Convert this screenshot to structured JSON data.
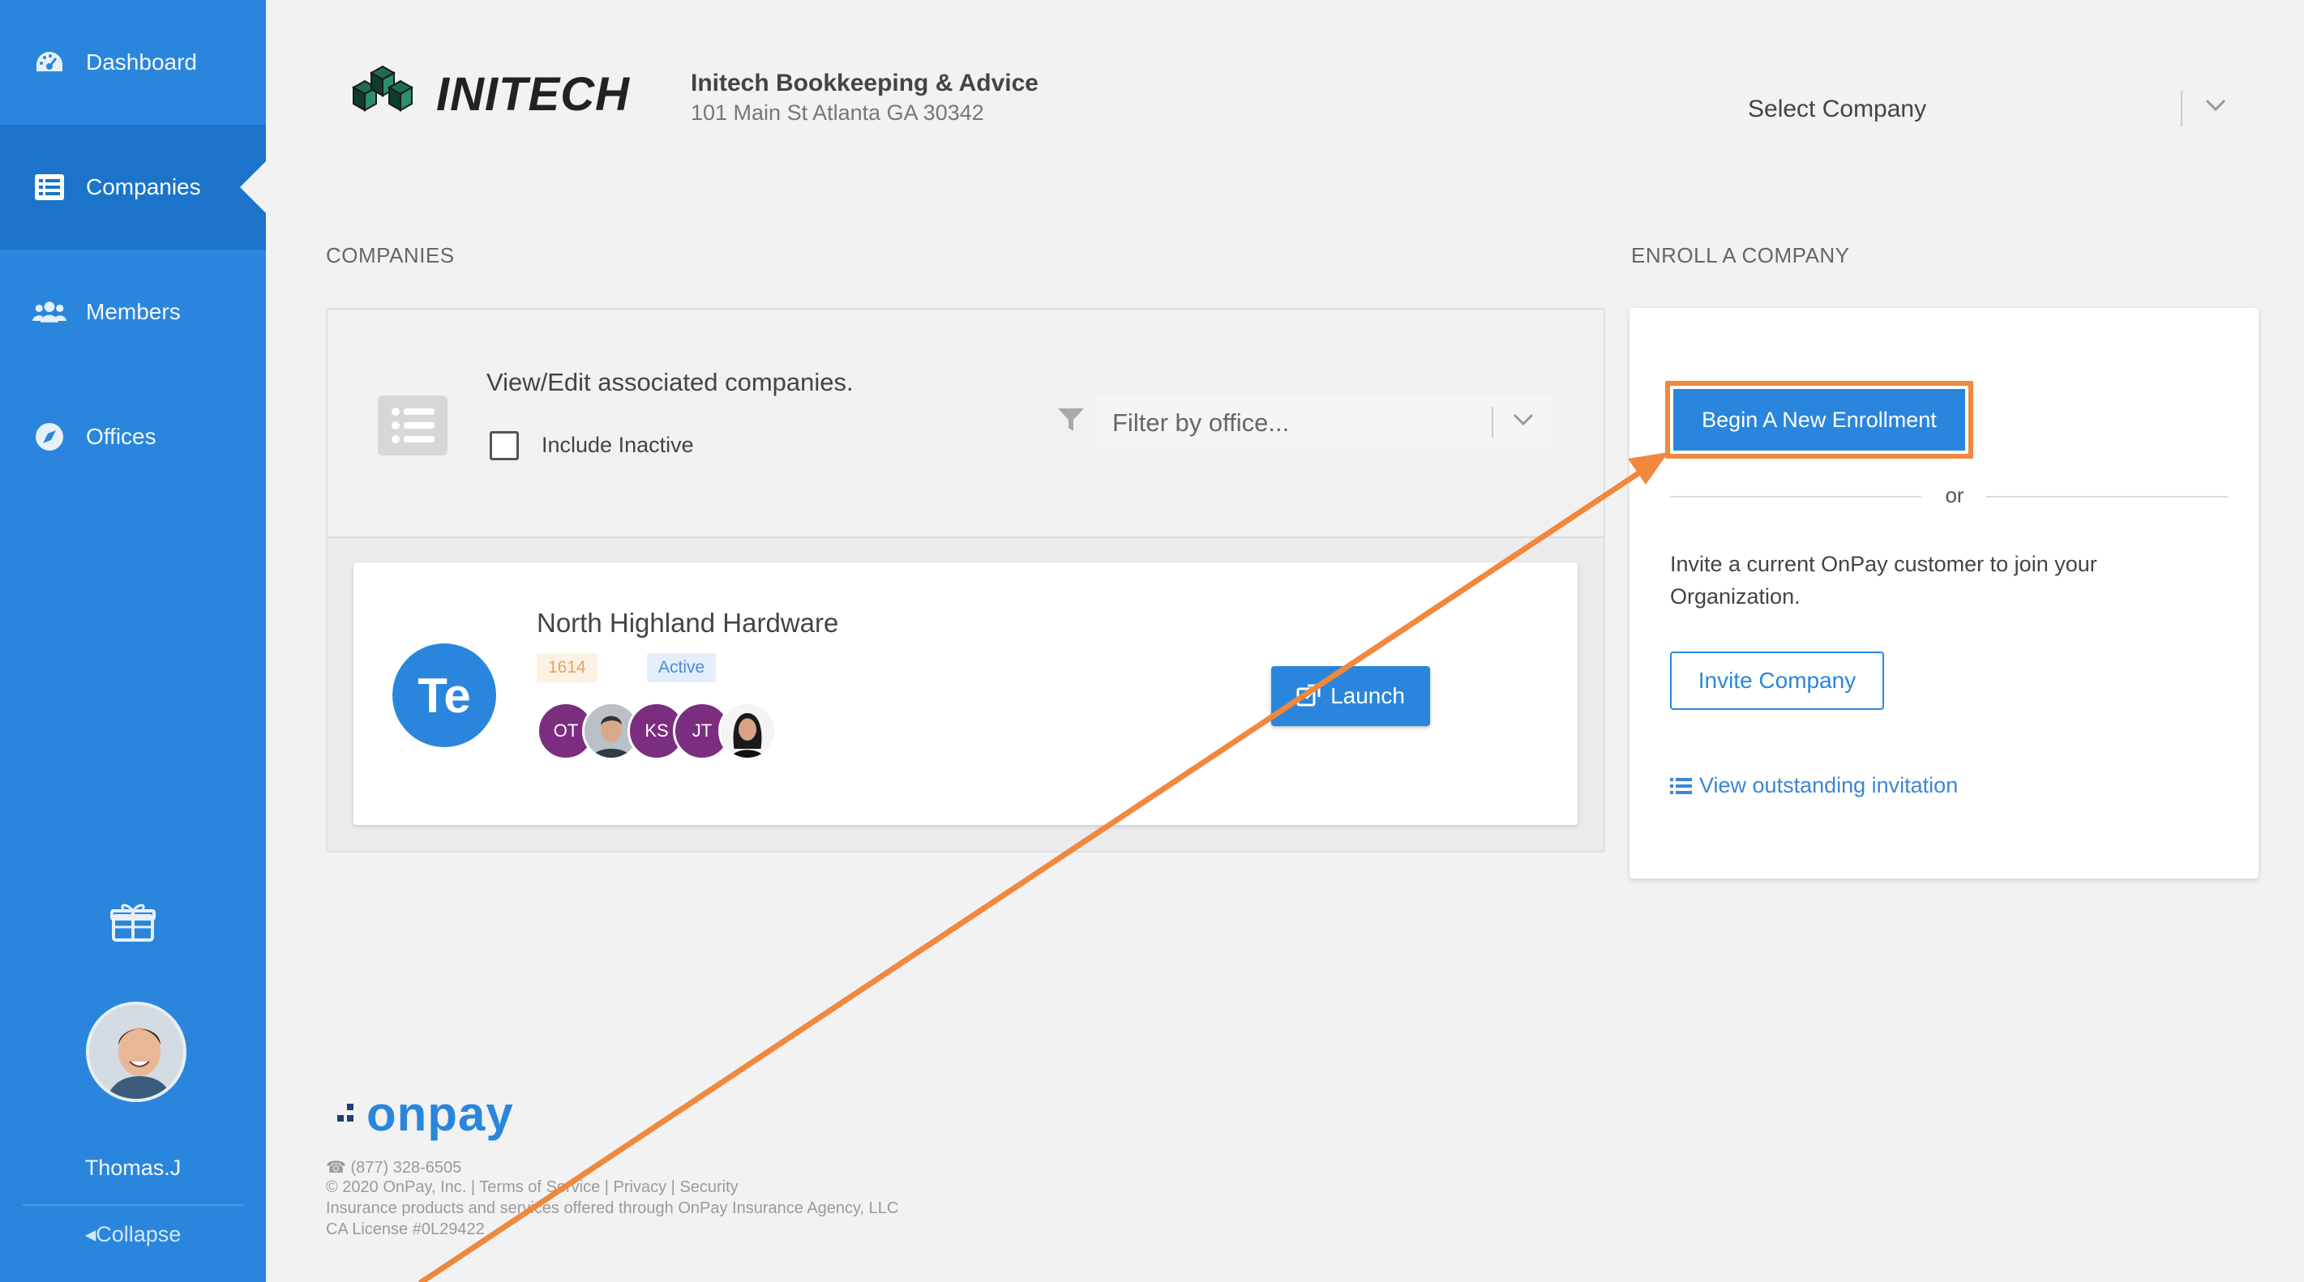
{
  "sidebar": {
    "items": [
      {
        "label": "Dashboard",
        "icon": "dashboard-icon"
      },
      {
        "label": "Companies",
        "icon": "list-icon"
      },
      {
        "label": "Members",
        "icon": "users-icon"
      },
      {
        "label": "Offices",
        "icon": "compass-icon"
      }
    ],
    "active_item": "Companies",
    "user_name": "Thomas.J",
    "collapse_label": "Collapse"
  },
  "header": {
    "logo_text": "INITECH",
    "firm_name": "Initech Bookkeeping & Advice",
    "firm_address": "101 Main St Atlanta GA 30342",
    "company_select_placeholder": "Select Company"
  },
  "companies": {
    "section_title": "COMPANIES",
    "description": "View/Edit associated companies.",
    "include_inactive_label": "Include Inactive",
    "include_inactive_checked": false,
    "filter_placeholder": "Filter by office...",
    "list": [
      {
        "initials": "Te",
        "name": "North Highland Hardware",
        "id": "1614",
        "status": "Active",
        "members": [
          "OT",
          "photo",
          "KS",
          "JT",
          "photo"
        ],
        "launch_label": "Launch"
      }
    ]
  },
  "enroll": {
    "section_title": "ENROLL A COMPANY",
    "begin_label": "Begin A New Enrollment",
    "or_text": "or",
    "invite_text": "Invite a current OnPay customer to join your Organization.",
    "invite_button": "Invite Company",
    "view_link": "View outstanding invitation"
  },
  "footer": {
    "brand": "onpay",
    "phone": "(877) 328-6505",
    "copyright": "© 2020 OnPay, Inc. | Terms of Service | Privacy | Security",
    "insurance": "Insurance products and services offered through OnPay Insurance Agency, LLC",
    "license": "CA License #0L29422"
  },
  "colors": {
    "sidebar": "#2a86dc",
    "sidebar_active": "#1b74c9",
    "primary": "#2a86dc",
    "highlight": "#f0883e",
    "member_purple": "#7b2d7f"
  }
}
